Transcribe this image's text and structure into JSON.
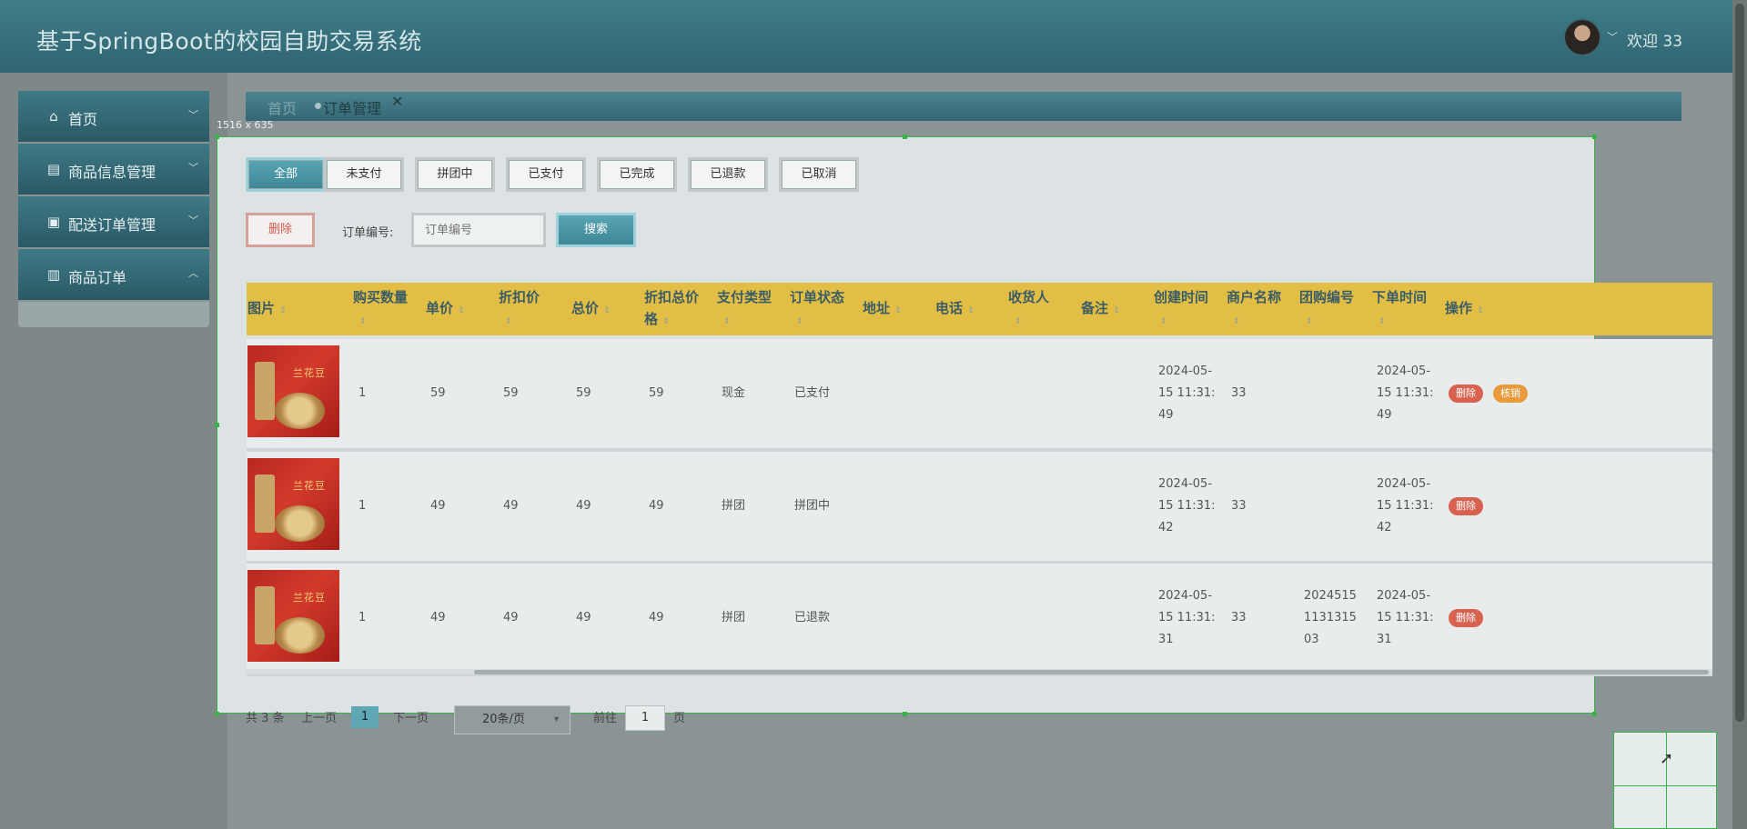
{
  "header": {
    "title": "基于SpringBoot的校园自助交易系统",
    "welcome": "欢迎 33",
    "caret": "﹀"
  },
  "sidebar": {
    "items": [
      {
        "label": "首页",
        "icon": "home-icon",
        "glyph": "⌂",
        "arrow": "﹀"
      },
      {
        "label": "商品信息管理",
        "icon": "layout-icon",
        "glyph": "▤",
        "arrow": "﹀"
      },
      {
        "label": "配送订单管理",
        "icon": "briefcase-icon",
        "glyph": "▣",
        "arrow": "﹀"
      },
      {
        "label": "商品订单",
        "icon": "server-icon",
        "glyph": "▥",
        "arrow": "︿"
      }
    ]
  },
  "tabs": {
    "home": "首页",
    "active": "订单管理",
    "close": "✕"
  },
  "overlay": {
    "size_label": "1516 x 635"
  },
  "filters": [
    "全部",
    "未支付",
    "拼团中",
    "已支付",
    "已完成",
    "已退款",
    "已取消"
  ],
  "toolbar": {
    "delete": "删除",
    "order_label": "订单编号:",
    "order_placeholder": "订单编号",
    "search": "搜索"
  },
  "table": {
    "headers": {
      "image": "图片",
      "qty_1": "购买数量",
      "price": "单价",
      "discount": "折扣价",
      "total": "总价",
      "dtotal_1": "折扣总价",
      "dtotal_2": "格",
      "pay_type": "支付类型",
      "status": "订单状态",
      "address": "地址",
      "phone": "电话",
      "receiver": "收货人",
      "remark": "备注",
      "created": "创建时间",
      "merchant": "商户名称",
      "group_no": "团购编号",
      "ordered": "下单时间",
      "ops": "操作"
    },
    "sort_glyph": "⇕",
    "rows": [
      {
        "qty": "1",
        "price": "59",
        "discount": "59",
        "total": "59",
        "dtotal": "59",
        "pay_type": "现金",
        "status": "已支付",
        "created_1": "2024-05-",
        "created_2": "15 11:31:",
        "created_3": "49",
        "merchant": "33",
        "group_1": "",
        "group_2": "",
        "group_3": "",
        "ordered_1": "2024-05-",
        "ordered_2": "15 11:31:",
        "ordered_3": "49",
        "op_delete": "删除",
        "op_verify": "核销"
      },
      {
        "qty": "1",
        "price": "49",
        "discount": "49",
        "total": "49",
        "dtotal": "49",
        "pay_type": "拼团",
        "status": "拼团中",
        "created_1": "2024-05-",
        "created_2": "15 11:31:",
        "created_3": "42",
        "merchant": "33",
        "group_1": "",
        "group_2": "",
        "group_3": "",
        "ordered_1": "2024-05-",
        "ordered_2": "15 11:31:",
        "ordered_3": "42",
        "op_delete": "删除"
      },
      {
        "qty": "1",
        "price": "49",
        "discount": "49",
        "total": "49",
        "dtotal": "49",
        "pay_type": "拼团",
        "status": "已退款",
        "created_1": "2024-05-",
        "created_2": "15 11:31:",
        "created_3": "31",
        "merchant": "33",
        "group_1": "2024515",
        "group_2": "1131315",
        "group_3": "03",
        "ordered_1": "2024-05-",
        "ordered_2": "15 11:31:",
        "ordered_3": "31",
        "op_delete": "删除"
      }
    ],
    "thumb_text": "兰花豆"
  },
  "pagination": {
    "total": "共 3 条",
    "prev": "上一页",
    "current": "1",
    "next": "下一页",
    "page_size": "20条/页",
    "goto": "前往",
    "goto_value": "1",
    "page_unit": "页"
  },
  "colors": {
    "header": "#2f6470",
    "table_header": "#e2bf44",
    "accent": "#3d8796",
    "danger": "#d8624f",
    "warning": "#e89a3d"
  }
}
